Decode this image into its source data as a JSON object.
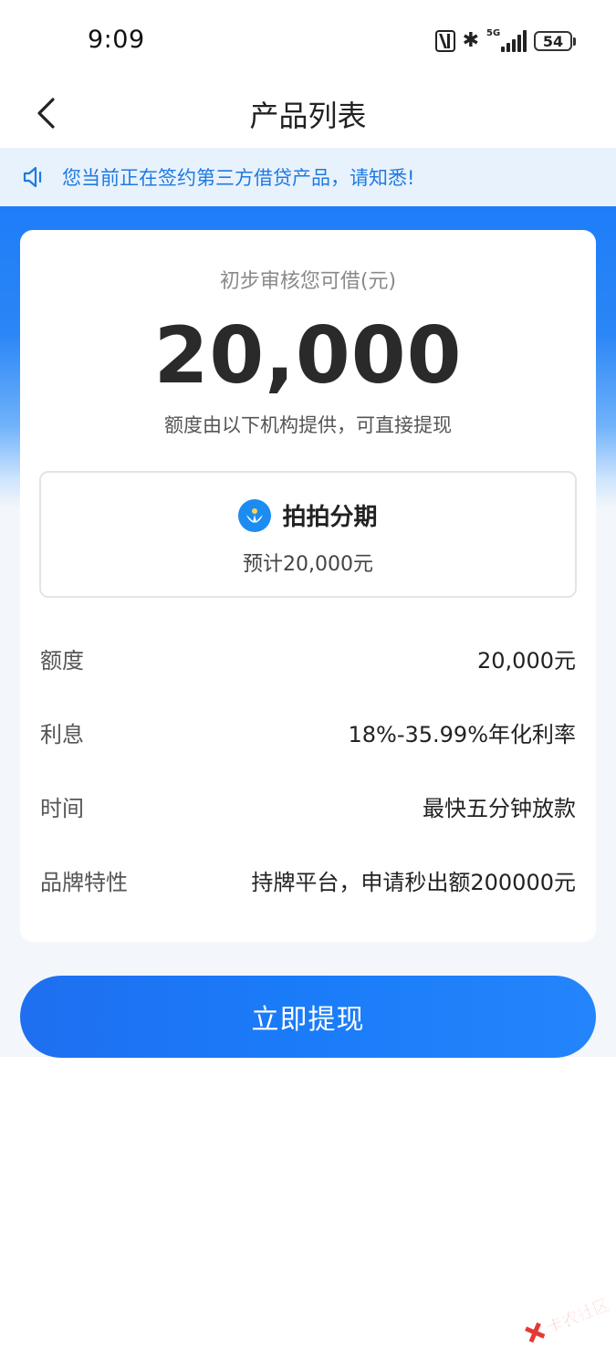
{
  "status_bar": {
    "time": "9:09",
    "network": "5G",
    "battery": "54"
  },
  "nav": {
    "title": "产品列表"
  },
  "notice": {
    "text": "您当前正在签约第三方借贷产品，请知悉!"
  },
  "offer": {
    "caption": "初步审核您可借(元)",
    "amount": "20,000",
    "note": "额度由以下机构提供，可直接提现"
  },
  "lender": {
    "name": "拍拍分期",
    "estimate": "预计20,000元"
  },
  "details": [
    {
      "label": "额度",
      "value": "20,000元"
    },
    {
      "label": "利息",
      "value": "18%-35.99%年化利率"
    },
    {
      "label": "时间",
      "value": "最快五分钟放款"
    },
    {
      "label": "品牌特性",
      "value": "持牌平台，申请秒出额200000元"
    }
  ],
  "cta": {
    "label": "立即提现"
  },
  "watermark": {
    "text": "卡农社区"
  },
  "colors": {
    "brand_blue": "#1e7df8",
    "notice_bg": "#e8f2fd",
    "notice_text": "#1f7ae0",
    "watermark_red": "#e53935"
  }
}
